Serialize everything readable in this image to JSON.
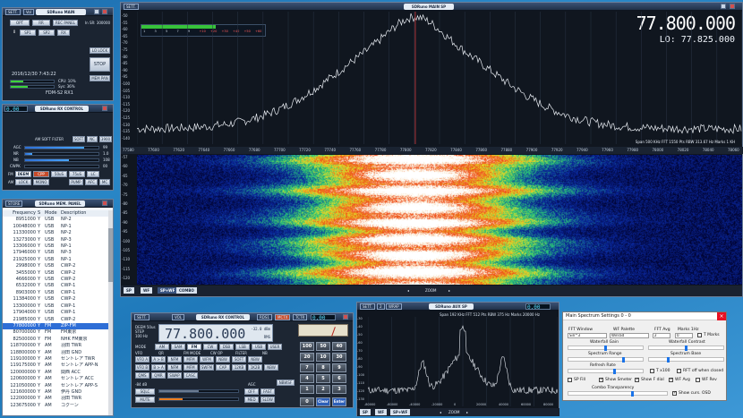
{
  "main_window": {
    "tab_sett": "SETT.",
    "title": "SDRuno",
    "subtitle": "MAIN SP",
    "freq": "77.800.000",
    "lo": "LO: 77.825.000",
    "status_line": "Span 500 KHz  FFT 1550 Pts  RBW 313.67 Hz  Marks 1 KH",
    "meter_scale": [
      "1",
      "3",
      "5",
      "7",
      "9",
      "+10",
      "+20",
      "+30",
      "+40",
      "+50",
      "+60"
    ],
    "db_labels": [
      "-50",
      "-55",
      "-60",
      "-65",
      "-70",
      "-75",
      "-80",
      "-85",
      "-90",
      "-95",
      "-100",
      "-105",
      "-110",
      "-115",
      "-120",
      "-125",
      "-130",
      "-135",
      "-140"
    ],
    "wf_db_labels": [
      "-57",
      "-60",
      "-65",
      "-70",
      "-75",
      "-80",
      "-85",
      "-90",
      "-95",
      "-100",
      "-105",
      "-110",
      "-115",
      "-120"
    ],
    "freq_axis": [
      "77580",
      "77600",
      "77620",
      "77640",
      "77660",
      "77680",
      "77700",
      "77720",
      "77740",
      "77760",
      "77780",
      "77800",
      "77820",
      "77840",
      "77860",
      "77880",
      "77900",
      "77920",
      "77940",
      "77960",
      "77980",
      "78000",
      "78020",
      "78040",
      "78060"
    ],
    "bottom_buttons": [
      "SP",
      "WF",
      "SP+WF",
      "COMBO"
    ],
    "zoom_label": "ZOOM",
    "spectrum_color": "#e9edf3",
    "cursor_color": "#d23a3a"
  },
  "tl_panel": {
    "sett": "SETT.",
    "vol": "Vol",
    "title": "SDRuno",
    "subtitle": "MAIN",
    "opt": "OPT",
    "rr": "RR",
    "rec_panel": "REC PANEL",
    "sr_label": "In SR: 300000",
    "btns2": [
      "0",
      "SP1",
      "SP2",
      "RX"
    ],
    "clock": "2016/12/30 7:43:22",
    "cpu": "CPU: 10%",
    "sys": "Sys: 36%",
    "lo_lock": "LO LOCK",
    "stop": "STOP",
    "mem_pan": "MEM PAN",
    "device": "FDM-S2 RX1"
  },
  "rx_control_small": {
    "sett": "SETT.",
    "title": "SDRuno",
    "subtitle": "RX CONTROL",
    "lcd": "0.00",
    "soft_filter": "AM SOFT FILTER",
    "soft_filter_v": "SOFT",
    "nc_btn": "NC",
    "nc_val": "3900",
    "agc": "AGC",
    "nr": "NR",
    "nb": "NB",
    "cwpk": "CWPK",
    "agc_v": "99",
    "nr_v": "1.0",
    "nb_v": "108",
    "cwpk_v": "00",
    "fm": "FM",
    "fm_btns": [
      "DEEM",
      "CPP",
      "50uS",
      "75uS",
      "LC"
    ],
    "am": "AM",
    "am_btns": [
      "LOCK",
      "MONO",
      "PUMP",
      "AFC",
      "MC"
    ]
  },
  "memory_panel": {
    "store": "STORE",
    "title": "SDRuno",
    "subtitle": "MEM. PANEL",
    "headers": [
      "Frequency",
      "S",
      "Mode",
      "Description"
    ],
    "rows": [
      [
        "8951000",
        "Y",
        "USB",
        "NP-2"
      ],
      [
        "10048000",
        "Y",
        "USB",
        "NP-1"
      ],
      [
        "11330000",
        "Y",
        "USB",
        "NP-2"
      ],
      [
        "13273000",
        "Y",
        "USB",
        "NP-3"
      ],
      [
        "13306000",
        "Y",
        "USB",
        "NP-1"
      ],
      [
        "17946000",
        "Y",
        "USB",
        "NP-3"
      ],
      [
        "21925000",
        "Y",
        "USB",
        "NP-1"
      ],
      [
        "2998000",
        "Y",
        "USB",
        "CWP-2"
      ],
      [
        "3455000",
        "Y",
        "USB",
        "CWP-2"
      ],
      [
        "4666000",
        "Y",
        "USB",
        "CWP-2"
      ],
      [
        "6532000",
        "Y",
        "USB",
        "CWP-1"
      ],
      [
        "8903000",
        "Y",
        "USB",
        "CWP-1"
      ],
      [
        "11384000",
        "Y",
        "USB",
        "CWP-2"
      ],
      [
        "13300000",
        "Y",
        "USB",
        "CWP-1"
      ],
      [
        "17904000",
        "Y",
        "USB",
        "CWP-1"
      ],
      [
        "21985000",
        "Y",
        "USB",
        "CWP-2"
      ],
      [
        "77800000",
        "Y",
        "FM",
        "ZIP-FM"
      ],
      [
        "80700000",
        "Y",
        "FM",
        "FM東京"
      ],
      [
        "82500000",
        "Y",
        "FM",
        "NHK FM東京"
      ],
      [
        "118700000",
        "Y",
        "AM",
        "羽田 TWR"
      ],
      [
        "118800000",
        "Y",
        "AM",
        "羽田 GND"
      ],
      [
        "119100000",
        "Y",
        "AM",
        "セントレア TWR"
      ],
      [
        "119175000",
        "Y",
        "AM",
        "セントレア APP-N"
      ],
      [
        "120000000",
        "Y",
        "AM",
        "関西 ACC"
      ],
      [
        "120600000",
        "Y",
        "AM",
        "セントレア ACC"
      ],
      [
        "121050000",
        "Y",
        "AM",
        "セントレア APP-S"
      ],
      [
        "121600000",
        "Y",
        "AM",
        "伊丹 GND"
      ],
      [
        "122000000",
        "Y",
        "AM",
        "羽田 TWR"
      ],
      [
        "123675000",
        "Y",
        "AM",
        "コクーン"
      ]
    ],
    "selected_index": 16
  },
  "rx_control_main": {
    "sett": "SETT.",
    "vol": "VOL",
    "title": "SDRuno",
    "subtitle": "RX CONTROL",
    "rds_btns": [
      "RDS1",
      "MCTX",
      "TCTR"
    ],
    "lcd": "0.00",
    "step_line1": "DEEM 50us",
    "step_line2": "STEP",
    "step_line3": "100 Hz",
    "freq": "77.800.000",
    "dbm": "-32.0 dBm",
    "rms": "RMS",
    "mode_label": "MODE",
    "modes": [
      "AM",
      "SAM",
      "FM",
      "CW",
      "DSB",
      "LSB",
      "USB",
      "USER"
    ],
    "vfo_label": "VFO",
    "qr_label": "QR",
    "fm_mode_label": "FM MODE",
    "cw_op_label": "CW OP",
    "filter_label": "FILTER",
    "nb_label": "NB",
    "row1": [
      "VFO A",
      "A > B",
      "NFM",
      "MFM",
      "WFM",
      "NBW",
      "SOFT",
      "NBW"
    ],
    "row2": [
      "VFO B",
      "B > A",
      "NFM",
      "MFM",
      "SWFM",
      "CAP",
      "12KB",
      "1K2B",
      "NBW"
    ],
    "row3": [
      "QMS",
      "QMR",
      "SWAP",
      "CASC"
    ],
    "afc_label": "AFC",
    "sq_label": "-84 dB",
    "agc_label": "AGC",
    "sqlc": "SQLC",
    "mute": "MUTE",
    "agc_btns": [
      "OFF",
      "FAST",
      "MED",
      "SLOW",
      "NBWSF"
    ],
    "keypad": [
      "100",
      "50",
      "40",
      "20",
      "10",
      "30",
      "7",
      "8",
      "9",
      "4",
      "5",
      "6",
      "1",
      "2",
      "3"
    ],
    "zero": "0",
    "clear": "Clear",
    "enter": "Enter"
  },
  "aux_sp": {
    "sett": "SETT.",
    "num": "2",
    "wrap": "WRAP",
    "title": "SDRuno",
    "subtitle": "AUX SP",
    "lcd": "0.00",
    "status_line": "Span 192 KHz  FFT 512 Pts  RBW 375 Hz  Marks 20000 Hz",
    "x_ticks": [
      "-80000",
      "-60000",
      "-40000",
      "-20000",
      "0",
      "20000",
      "40000",
      "60000",
      "80000"
    ],
    "db_labels": [
      "-30",
      "-40",
      "-50",
      "-60",
      "-70",
      "-80",
      "-90",
      "-100",
      "-110",
      "-120",
      "-130"
    ],
    "bottom_buttons": [
      "SP",
      "WF",
      "SP+WF"
    ],
    "zoom_label": "ZOOM"
  },
  "settings_dialog": {
    "title": "Main Spectrum Settings 0 - 0",
    "close": "×",
    "fft_window_label": "FFT Window",
    "wf_palette_label": "WF Palette",
    "fft_avg_label": "FFT Avg",
    "marks_label": "Marks 1Hz",
    "fft_window_v": "Sin^3",
    "wf_palette_v": "Winrad",
    "fft_avg_v": "2",
    "marks_v": "0",
    "t_marks": "T Marks",
    "waterfall_gain": "Waterfall Gain",
    "waterfall_contrast": "Waterfall Contrast",
    "spectrum_range": "Spectrum Range",
    "spectrum_base": "Spectrum Base",
    "refresh_rate": "Refresh Rate",
    "t_x100": "T x100",
    "rft_off": "RFT off when closed",
    "sp_fill": "SP Fill",
    "show_smeter": "Show Smeter",
    "show_f_dial": "Show F dial",
    "wf_avg": "WF Avg",
    "wf_rev": "WF Rev",
    "combo_transparency": "Combo Transparency",
    "show_curs": "Show curs. OSD"
  }
}
